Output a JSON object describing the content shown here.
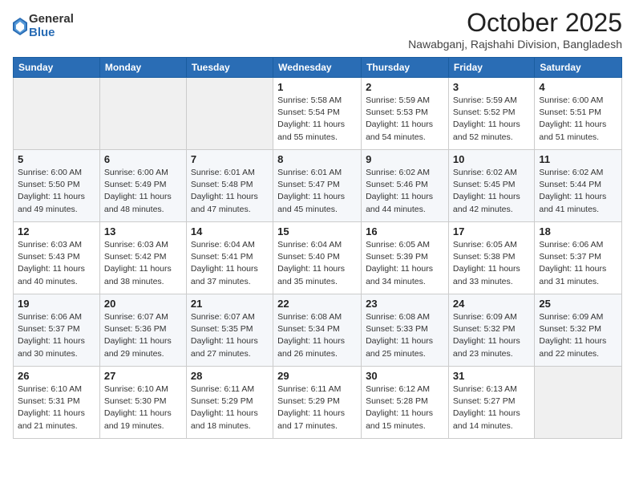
{
  "logo": {
    "general": "General",
    "blue": "Blue"
  },
  "header": {
    "month": "October 2025",
    "location": "Nawabganj, Rajshahi Division, Bangladesh"
  },
  "weekdays": [
    "Sunday",
    "Monday",
    "Tuesday",
    "Wednesday",
    "Thursday",
    "Friday",
    "Saturday"
  ],
  "weeks": [
    [
      {
        "day": "",
        "info": ""
      },
      {
        "day": "",
        "info": ""
      },
      {
        "day": "",
        "info": ""
      },
      {
        "day": "1",
        "info": "Sunrise: 5:58 AM\nSunset: 5:54 PM\nDaylight: 11 hours\nand 55 minutes."
      },
      {
        "day": "2",
        "info": "Sunrise: 5:59 AM\nSunset: 5:53 PM\nDaylight: 11 hours\nand 54 minutes."
      },
      {
        "day": "3",
        "info": "Sunrise: 5:59 AM\nSunset: 5:52 PM\nDaylight: 11 hours\nand 52 minutes."
      },
      {
        "day": "4",
        "info": "Sunrise: 6:00 AM\nSunset: 5:51 PM\nDaylight: 11 hours\nand 51 minutes."
      }
    ],
    [
      {
        "day": "5",
        "info": "Sunrise: 6:00 AM\nSunset: 5:50 PM\nDaylight: 11 hours\nand 49 minutes."
      },
      {
        "day": "6",
        "info": "Sunrise: 6:00 AM\nSunset: 5:49 PM\nDaylight: 11 hours\nand 48 minutes."
      },
      {
        "day": "7",
        "info": "Sunrise: 6:01 AM\nSunset: 5:48 PM\nDaylight: 11 hours\nand 47 minutes."
      },
      {
        "day": "8",
        "info": "Sunrise: 6:01 AM\nSunset: 5:47 PM\nDaylight: 11 hours\nand 45 minutes."
      },
      {
        "day": "9",
        "info": "Sunrise: 6:02 AM\nSunset: 5:46 PM\nDaylight: 11 hours\nand 44 minutes."
      },
      {
        "day": "10",
        "info": "Sunrise: 6:02 AM\nSunset: 5:45 PM\nDaylight: 11 hours\nand 42 minutes."
      },
      {
        "day": "11",
        "info": "Sunrise: 6:02 AM\nSunset: 5:44 PM\nDaylight: 11 hours\nand 41 minutes."
      }
    ],
    [
      {
        "day": "12",
        "info": "Sunrise: 6:03 AM\nSunset: 5:43 PM\nDaylight: 11 hours\nand 40 minutes."
      },
      {
        "day": "13",
        "info": "Sunrise: 6:03 AM\nSunset: 5:42 PM\nDaylight: 11 hours\nand 38 minutes."
      },
      {
        "day": "14",
        "info": "Sunrise: 6:04 AM\nSunset: 5:41 PM\nDaylight: 11 hours\nand 37 minutes."
      },
      {
        "day": "15",
        "info": "Sunrise: 6:04 AM\nSunset: 5:40 PM\nDaylight: 11 hours\nand 35 minutes."
      },
      {
        "day": "16",
        "info": "Sunrise: 6:05 AM\nSunset: 5:39 PM\nDaylight: 11 hours\nand 34 minutes."
      },
      {
        "day": "17",
        "info": "Sunrise: 6:05 AM\nSunset: 5:38 PM\nDaylight: 11 hours\nand 33 minutes."
      },
      {
        "day": "18",
        "info": "Sunrise: 6:06 AM\nSunset: 5:37 PM\nDaylight: 11 hours\nand 31 minutes."
      }
    ],
    [
      {
        "day": "19",
        "info": "Sunrise: 6:06 AM\nSunset: 5:37 PM\nDaylight: 11 hours\nand 30 minutes."
      },
      {
        "day": "20",
        "info": "Sunrise: 6:07 AM\nSunset: 5:36 PM\nDaylight: 11 hours\nand 29 minutes."
      },
      {
        "day": "21",
        "info": "Sunrise: 6:07 AM\nSunset: 5:35 PM\nDaylight: 11 hours\nand 27 minutes."
      },
      {
        "day": "22",
        "info": "Sunrise: 6:08 AM\nSunset: 5:34 PM\nDaylight: 11 hours\nand 26 minutes."
      },
      {
        "day": "23",
        "info": "Sunrise: 6:08 AM\nSunset: 5:33 PM\nDaylight: 11 hours\nand 25 minutes."
      },
      {
        "day": "24",
        "info": "Sunrise: 6:09 AM\nSunset: 5:32 PM\nDaylight: 11 hours\nand 23 minutes."
      },
      {
        "day": "25",
        "info": "Sunrise: 6:09 AM\nSunset: 5:32 PM\nDaylight: 11 hours\nand 22 minutes."
      }
    ],
    [
      {
        "day": "26",
        "info": "Sunrise: 6:10 AM\nSunset: 5:31 PM\nDaylight: 11 hours\nand 21 minutes."
      },
      {
        "day": "27",
        "info": "Sunrise: 6:10 AM\nSunset: 5:30 PM\nDaylight: 11 hours\nand 19 minutes."
      },
      {
        "day": "28",
        "info": "Sunrise: 6:11 AM\nSunset: 5:29 PM\nDaylight: 11 hours\nand 18 minutes."
      },
      {
        "day": "29",
        "info": "Sunrise: 6:11 AM\nSunset: 5:29 PM\nDaylight: 11 hours\nand 17 minutes."
      },
      {
        "day": "30",
        "info": "Sunrise: 6:12 AM\nSunset: 5:28 PM\nDaylight: 11 hours\nand 15 minutes."
      },
      {
        "day": "31",
        "info": "Sunrise: 6:13 AM\nSunset: 5:27 PM\nDaylight: 11 hours\nand 14 minutes."
      },
      {
        "day": "",
        "info": ""
      }
    ]
  ]
}
